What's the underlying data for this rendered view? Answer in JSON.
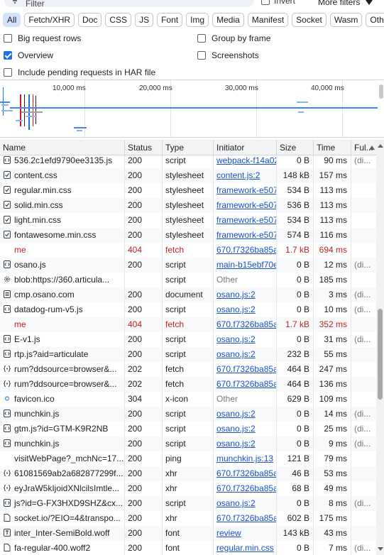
{
  "filter": {
    "placeholder": "Filter",
    "invert_label": "Invert",
    "more_filters_label": "More filters"
  },
  "type_chips": [
    "All",
    "Fetch/XHR",
    "Doc",
    "CSS",
    "JS",
    "Font",
    "Img",
    "Media",
    "Manifest",
    "Socket",
    "Wasm",
    "Other"
  ],
  "options": {
    "big_request_rows": {
      "label": "Big request rows",
      "checked": false
    },
    "group_by_frame": {
      "label": "Group by frame",
      "checked": false
    },
    "overview": {
      "label": "Overview",
      "checked": true
    },
    "screenshots": {
      "label": "Screenshots",
      "checked": false
    },
    "include_pending": {
      "label": "Include pending requests in HAR file",
      "checked": false
    }
  },
  "overview": {
    "ticks": [
      "10,000 ms",
      "20,000 ms",
      "30,000 ms",
      "40,000 ms"
    ]
  },
  "columns": {
    "name": "Name",
    "status": "Status",
    "type": "Type",
    "initiator": "Initiator",
    "size": "Size",
    "time": "Time",
    "full": "Ful..."
  },
  "colors": {
    "error": "#c5221f",
    "link": "#1a52c7",
    "active_chip": "#d3e3fd"
  },
  "rows": [
    {
      "icon": "script-icon",
      "name": "536.2c1efd9790ee3135.js",
      "status": "200",
      "type": "script",
      "initiator": "webpack-f14a02",
      "initiator_link": true,
      "size": "0 B",
      "time": "90 ms",
      "full": "(di..."
    },
    {
      "icon": "stylesheet-icon",
      "name": "content.css",
      "status": "200",
      "type": "stylesheet",
      "initiator": "content.js:2",
      "initiator_link": true,
      "size": "148 kB",
      "time": "157 ms",
      "full": ""
    },
    {
      "icon": "stylesheet-icon",
      "name": "regular.min.css",
      "status": "200",
      "type": "stylesheet",
      "initiator": "framework-e507",
      "initiator_link": true,
      "size": "534 B",
      "time": "113 ms",
      "full": ""
    },
    {
      "icon": "stylesheet-icon",
      "name": "solid.min.css",
      "status": "200",
      "type": "stylesheet",
      "initiator": "framework-e507",
      "initiator_link": true,
      "size": "536 B",
      "time": "113 ms",
      "full": ""
    },
    {
      "icon": "stylesheet-icon",
      "name": "light.min.css",
      "status": "200",
      "type": "stylesheet",
      "initiator": "framework-e507",
      "initiator_link": true,
      "size": "534 B",
      "time": "113 ms",
      "full": ""
    },
    {
      "icon": "stylesheet-icon",
      "name": "fontawesome.min.css",
      "status": "200",
      "type": "stylesheet",
      "initiator": "framework-e507",
      "initiator_link": true,
      "size": "574 B",
      "time": "116 ms",
      "full": ""
    },
    {
      "icon": "none",
      "name": "me",
      "status": "404",
      "type": "fetch",
      "initiator": "670.f7326ba85a",
      "initiator_link": true,
      "size": "1.7 kB",
      "time": "694 ms",
      "full": "",
      "error": true
    },
    {
      "icon": "script-icon",
      "name": "osano.js",
      "status": "200",
      "type": "script",
      "initiator": "main-b15ebf70e",
      "initiator_link": true,
      "size": "0 B",
      "time": "12 ms",
      "full": "(di..."
    },
    {
      "icon": "gear-icon",
      "name": "blob:https://360.articula...",
      "status": "",
      "type": "script",
      "initiator": "Other",
      "initiator_link": false,
      "size": "0 B",
      "time": "185 ms",
      "full": ""
    },
    {
      "icon": "document-icon",
      "name": "cmp.osano.com",
      "status": "200",
      "type": "document",
      "initiator": "osano.js:2",
      "initiator_link": true,
      "size": "0 B",
      "time": "3 ms",
      "full": "(di..."
    },
    {
      "icon": "script-icon",
      "name": "datadog-rum-v5.js",
      "status": "200",
      "type": "script",
      "initiator": "osano.js:2",
      "initiator_link": true,
      "size": "0 B",
      "time": "10 ms",
      "full": "(di..."
    },
    {
      "icon": "none",
      "name": "me",
      "status": "404",
      "type": "fetch",
      "initiator": "670.f7326ba85a",
      "initiator_link": true,
      "size": "1.7 kB",
      "time": "352 ms",
      "full": "",
      "error": true
    },
    {
      "icon": "script-icon",
      "name": "E-v1.js",
      "status": "200",
      "type": "script",
      "initiator": "osano.js:2",
      "initiator_link": true,
      "size": "0 B",
      "time": "31 ms",
      "full": "(di..."
    },
    {
      "icon": "script-icon",
      "name": "rtp.js?aid=articulate",
      "status": "200",
      "type": "script",
      "initiator": "osano.js:2",
      "initiator_link": true,
      "size": "232 B",
      "time": "55 ms",
      "full": ""
    },
    {
      "icon": "fetch-icon",
      "name": "rum?ddsource=browser&...",
      "status": "202",
      "type": "fetch",
      "initiator": "670.f7326ba85a",
      "initiator_link": true,
      "size": "464 B",
      "time": "247 ms",
      "full": ""
    },
    {
      "icon": "fetch-icon",
      "name": "rum?ddsource=browser&...",
      "status": "202",
      "type": "fetch",
      "initiator": "670.f7326ba85a",
      "initiator_link": true,
      "size": "464 B",
      "time": "136 ms",
      "full": ""
    },
    {
      "icon": "dot-icon",
      "name": "favicon.ico",
      "status": "304",
      "type": "x-icon",
      "initiator": "Other",
      "initiator_link": false,
      "size": "629 B",
      "time": "109 ms",
      "full": ""
    },
    {
      "icon": "script-icon",
      "name": "munchkin.js",
      "status": "200",
      "type": "script",
      "initiator": "osano.js:2",
      "initiator_link": true,
      "size": "0 B",
      "time": "14 ms",
      "full": "(di..."
    },
    {
      "icon": "script-icon",
      "name": "gtm.js?id=GTM-K9R2NB",
      "status": "200",
      "type": "script",
      "initiator": "osano.js:2",
      "initiator_link": true,
      "size": "0 B",
      "time": "25 ms",
      "full": "(di..."
    },
    {
      "icon": "script-icon",
      "name": "munchkin.js",
      "status": "200",
      "type": "script",
      "initiator": "osano.js:2",
      "initiator_link": true,
      "size": "0 B",
      "time": "9 ms",
      "full": "(di..."
    },
    {
      "icon": "none",
      "name": "visitWebPage?_mchNc=17...",
      "status": "200",
      "type": "ping",
      "initiator": "munchkin.js:13",
      "initiator_link": true,
      "size": "121 B",
      "time": "79 ms",
      "full": ""
    },
    {
      "icon": "fetch-icon",
      "name": "61081569ab2a682877299f...",
      "status": "200",
      "type": "xhr",
      "initiator": "670.f7326ba85a",
      "initiator_link": true,
      "size": "46 B",
      "time": "53 ms",
      "full": ""
    },
    {
      "icon": "fetch-icon",
      "name": "eyJraW5kIjoidXNlcilsImtle...",
      "status": "200",
      "type": "xhr",
      "initiator": "670.f7326ba85a",
      "initiator_link": true,
      "size": "68 B",
      "time": "49 ms",
      "full": ""
    },
    {
      "icon": "script-icon",
      "name": "js?id=G-FX3HXD9SHZ&cx...",
      "status": "200",
      "type": "script",
      "initiator": "osano.js:2",
      "initiator_link": true,
      "size": "0 B",
      "time": "8 ms",
      "full": "(di..."
    },
    {
      "icon": "doc-plain-icon",
      "name": "socket.io/?EIO=4&transpo...",
      "status": "200",
      "type": "xhr",
      "initiator": "670.f7326ba85a",
      "initiator_link": true,
      "size": "602 B",
      "time": "175 ms",
      "full": ""
    },
    {
      "icon": "font-icon",
      "name": "inter_Inter-SemiBold.woff",
      "status": "200",
      "type": "font",
      "initiator": "review",
      "initiator_link": true,
      "size": "143 kB",
      "time": "43 ms",
      "full": ""
    },
    {
      "icon": "doc-plain-icon",
      "name": "fa-regular-400.woff2",
      "status": "200",
      "type": "font",
      "initiator": "regular.min.css",
      "initiator_link": true,
      "size": "0 B",
      "time": "7 ms",
      "full": "(di..."
    }
  ]
}
